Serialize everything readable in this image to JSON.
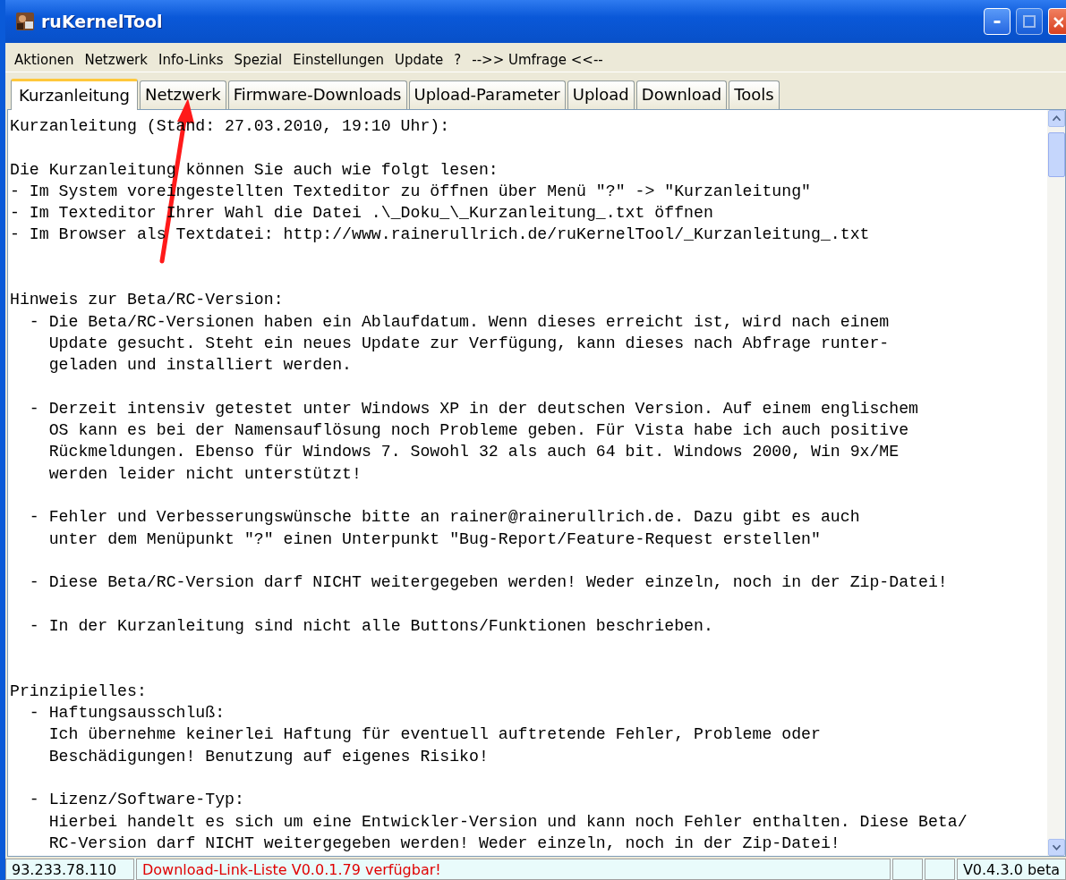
{
  "window": {
    "title": "ruKernelTool"
  },
  "menu": [
    "Aktionen",
    "Netzwerk",
    "Info-Links",
    "Spezial",
    "Einstellungen",
    "Update",
    "?",
    "-->> Umfrage <<--"
  ],
  "tabs": [
    {
      "label": "Kurzanleitung",
      "selected": true
    },
    {
      "label": "Netzwerk",
      "selected": false
    },
    {
      "label": "Firmware-Downloads",
      "selected": false
    },
    {
      "label": "Upload-Parameter",
      "selected": false
    },
    {
      "label": "Upload",
      "selected": false
    },
    {
      "label": "Download",
      "selected": false
    },
    {
      "label": "Tools",
      "selected": false
    }
  ],
  "annotation": {
    "kind": "arrow"
  },
  "document": [
    {
      "kind": "section",
      "lines": [
        "Kurzanleitung (Stand: 27.03.2010, 19:10 Uhr):"
      ]
    },
    {
      "kind": "item",
      "lines": [
        "Die Kurzanleitung können Sie auch wie folgt lesen:",
        "- Im System voreingestellten Texteditor zu öffnen über Menü \"?\" -> \"Kurzanleitung\"",
        "- Im Texteditor Ihrer Wahl die Datei .\\_Doku_\\_Kurzanleitung_.txt öffnen",
        "- Im Browser als Textdatei: http://www.rainerullrich.de/ruKernelTool/_Kurzanleitung_.txt"
      ]
    },
    {
      "kind": "section",
      "lines": [
        "Hinweis zur Beta/RC-Version:",
        "  - Die Beta/RC-Versionen haben ein Ablaufdatum. Wenn dieses erreicht ist, wird nach einem",
        "    Update gesucht. Steht ein neues Update zur Verfügung, kann dieses nach Abfrage runter-",
        "    geladen und installiert werden."
      ]
    },
    {
      "kind": "item",
      "lines": [
        "  - Derzeit intensiv getestet unter Windows XP in der deutschen Version. Auf einem englischem",
        "    OS kann es bei der Namensauflösung noch Probleme geben. Für Vista habe ich auch positive",
        "    Rückmeldungen. Ebenso für Windows 7. Sowohl 32 als auch 64 bit. Windows 2000, Win 9x/ME",
        "    werden leider nicht unterstützt!"
      ]
    },
    {
      "kind": "item",
      "lines": [
        "  - Fehler und Verbesserungswünsche bitte an rainer@rainerullrich.de. Dazu gibt es auch",
        "    unter dem Menüpunkt \"?\" einen Unterpunkt \"Bug-Report/Feature-Request erstellen\""
      ]
    },
    {
      "kind": "item",
      "lines": [
        "  - Diese Beta/RC-Version darf NICHT weitergegeben werden! Weder einzeln, noch in der Zip-Datei!"
      ]
    },
    {
      "kind": "item",
      "lines": [
        "  - In der Kurzanleitung sind nicht alle Buttons/Funktionen beschrieben."
      ]
    },
    {
      "kind": "section",
      "lines": [
        "Prinzipielles:",
        "  - Haftungsausschluß:",
        "    Ich übernehme keinerlei Haftung für eventuell auftretende Fehler, Probleme oder",
        "    Beschädigungen! Benutzung auf eigenes Risiko!"
      ]
    },
    {
      "kind": "item",
      "lines": [
        "  - Lizenz/Software-Typ:",
        "    Hierbei handelt es sich um eine Entwickler-Version und kann noch Fehler enthalten. Diese Beta/",
        "    RC-Version darf NICHT weitergegeben werden! Weder einzeln, noch in der Zip-Datei!"
      ]
    }
  ],
  "status_bar": {
    "ip": "93.233.78.110",
    "message": "Download-Link-Liste V0.0.1.79 verfügbar!",
    "version": "V0.4.3.0 beta"
  }
}
